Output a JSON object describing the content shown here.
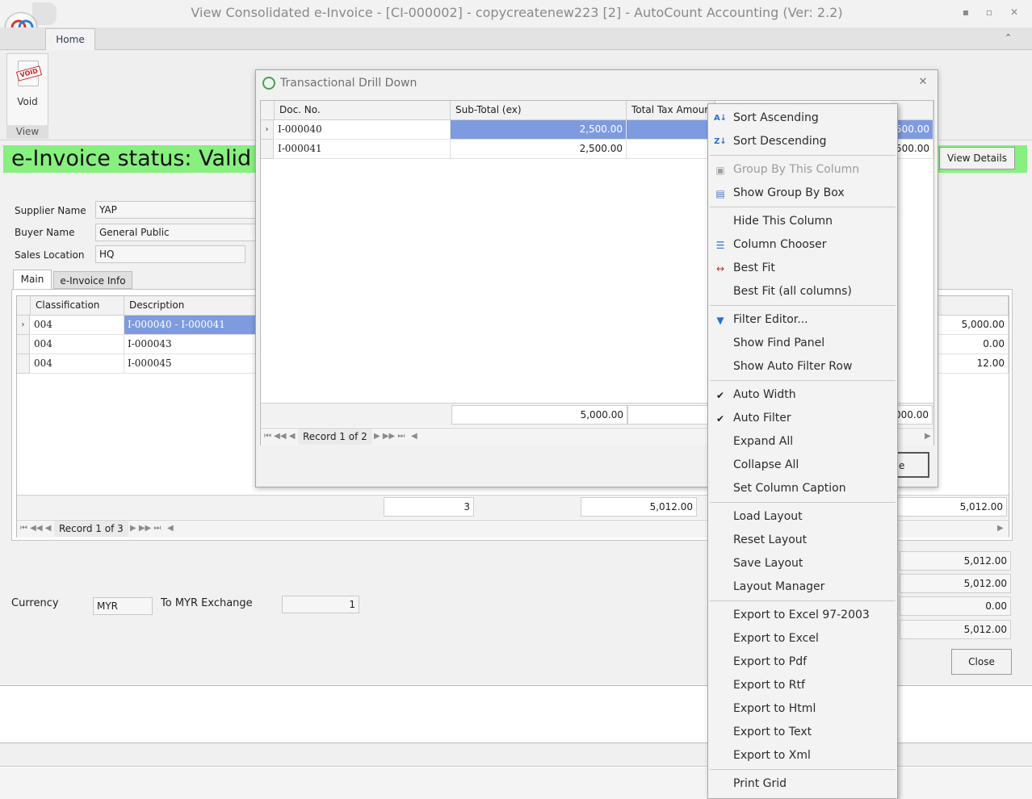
{
  "window": {
    "title": "View Consolidated e-Invoice - [CI-000002] - copycreatenew223 [2] - AutoCount Accounting (Ver: 2.2)",
    "minimize": "▪",
    "maximize": "▫",
    "close": "✕"
  },
  "ribbon": {
    "tab_home": "Home",
    "void_label": "Void",
    "void_stamp": "VOID",
    "group_view": "View",
    "collapse": "⌃"
  },
  "status": {
    "text": "e-Invoice status: Valid",
    "view_details": "View Details",
    "color": "#87f07f"
  },
  "form": {
    "supplier_label": "Supplier Name",
    "supplier_value": "YAP",
    "buyer_label": "Buyer Name",
    "buyer_value": "General Public",
    "location_label": "Sales Location",
    "location_value": "HQ",
    "tab_main": "Main",
    "tab_info": "e-Invoice Info",
    "currency_label": "Currency",
    "currency_value": "MYR",
    "exchange_label": "To MYR Exchange",
    "exchange_value": "1",
    "close": "Close"
  },
  "main_grid": {
    "col_classification": "Classification",
    "col_description": "Description",
    "rows": [
      {
        "classification": "004",
        "description": "I-000040 - I-000041",
        "right_value": "5,000.00"
      },
      {
        "classification": "004",
        "description": "I-000043",
        "right_value": "0.00"
      },
      {
        "classification": "004",
        "description": "I-000045",
        "right_value": "12.00"
      }
    ],
    "footer_count": "3",
    "footer_total": "5,012.00",
    "footer_right": "5,012.00",
    "record_text": "Record 1 of 3"
  },
  "totals": [
    "5,012.00",
    "5,012.00",
    "0.00",
    "5,012.00"
  ],
  "drill": {
    "title": "Transactional Drill Down",
    "col_doc": "Doc. No.",
    "col_subtotal": "Sub-Total (ex)",
    "col_tax": "Total Tax Amour",
    "rows": [
      {
        "doc": "I-000040",
        "subtotal": "2,500.00",
        "right": "500.00"
      },
      {
        "doc": "I-000041",
        "subtotal": "2,500.00",
        "right": "500.00"
      }
    ],
    "footer_subtotal": "5,000.00",
    "footer_right": "000.00",
    "record_text": "Record 1 of 2",
    "btn_partial": "e",
    "close_glyph": "✕"
  },
  "menu": {
    "items": [
      {
        "label": "Sort Ascending",
        "icon": "sort-ascending-icon",
        "glyph": "A↓"
      },
      {
        "label": "Sort Descending",
        "icon": "sort-descending-icon",
        "glyph": "Z↓"
      },
      {
        "label": "Group By This Column",
        "icon": "group-by-column-icon",
        "glyph": "▣",
        "disabled": true
      },
      {
        "label": "Show Group By Box",
        "icon": "group-by-box-icon",
        "glyph": "▤"
      },
      {
        "label": "Hide This Column",
        "icon": "",
        "glyph": ""
      },
      {
        "label": "Column Chooser",
        "icon": "column-chooser-icon",
        "glyph": "☰"
      },
      {
        "label": "Best Fit",
        "icon": "best-fit-icon",
        "glyph": "↔"
      },
      {
        "label": "Best Fit (all columns)",
        "icon": "",
        "glyph": ""
      },
      {
        "label": "Filter Editor...",
        "icon": "filter-icon",
        "glyph": "▼"
      },
      {
        "label": "Show Find Panel",
        "icon": "",
        "glyph": ""
      },
      {
        "label": "Show Auto Filter Row",
        "icon": "",
        "glyph": ""
      },
      {
        "label": "Auto Width",
        "icon": "checkmark-icon",
        "glyph": "✔"
      },
      {
        "label": "Auto Filter",
        "icon": "checkmark-icon",
        "glyph": "✔"
      },
      {
        "label": "Expand All",
        "icon": "",
        "glyph": ""
      },
      {
        "label": "Collapse All",
        "icon": "",
        "glyph": ""
      },
      {
        "label": "Set Column Caption",
        "icon": "",
        "glyph": ""
      },
      {
        "label": "Load Layout",
        "icon": "",
        "glyph": ""
      },
      {
        "label": "Reset Layout",
        "icon": "",
        "glyph": ""
      },
      {
        "label": "Save Layout",
        "icon": "",
        "glyph": ""
      },
      {
        "label": "Layout Manager",
        "icon": "",
        "glyph": ""
      },
      {
        "label": "Export to Excel 97-2003",
        "icon": "",
        "glyph": ""
      },
      {
        "label": "Export to Excel",
        "icon": "",
        "glyph": ""
      },
      {
        "label": "Export to Pdf",
        "icon": "",
        "glyph": ""
      },
      {
        "label": "Export to Rtf",
        "icon": "",
        "glyph": ""
      },
      {
        "label": "Export to Html",
        "icon": "",
        "glyph": ""
      },
      {
        "label": "Export to Text",
        "icon": "",
        "glyph": ""
      },
      {
        "label": "Export to Xml",
        "icon": "",
        "glyph": ""
      },
      {
        "label": "Print Grid",
        "icon": "",
        "glyph": ""
      }
    ]
  }
}
